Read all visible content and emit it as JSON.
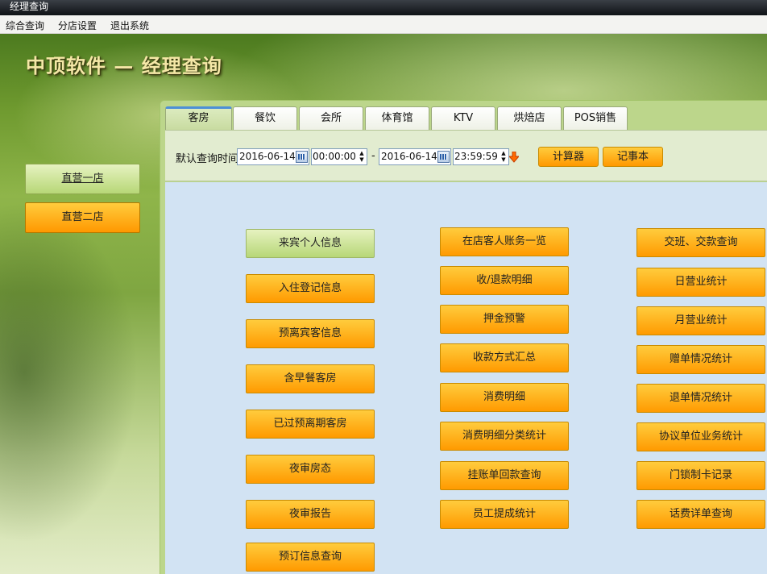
{
  "window": {
    "title": "经理查询"
  },
  "menu": [
    "综合查询",
    "分店设置",
    "退出系统"
  ],
  "header": {
    "logo": "中顶软件 — 经理查询"
  },
  "branches": [
    "直营一店",
    "直营二店"
  ],
  "tabs": [
    "客房",
    "餐饮",
    "会所",
    "体育馆",
    "KTV",
    "烘焙店",
    "POS销售"
  ],
  "filter": {
    "label": "默认查询时间",
    "start_date": "2016-06-14",
    "start_time": "00:00:00",
    "separator": "-",
    "end_date": "2016-06-14",
    "end_time": "23:59:59",
    "calculator_label": "计算器",
    "notepad_label": "记事本"
  },
  "functions": {
    "col1": [
      "来宾个人信息",
      "入住登记信息",
      "预离宾客信息",
      "含早餐客房",
      "已过预离期客房",
      "夜审房态",
      "夜审报告",
      "预订信息查询"
    ],
    "col2": [
      "在店客人账务一览",
      "收/退款明细",
      "押金预警",
      "收款方式汇总",
      "消费明细",
      "消费明细分类统计",
      "挂账单回款查询",
      "员工提成统计"
    ],
    "col3": [
      "交班、交款查询",
      "日营业统计",
      "月营业统计",
      "赠单情况统计",
      "退单情况统计",
      "协议单位业务统计",
      "门锁制卡记录",
      "话费详单查询"
    ]
  },
  "colors": {
    "button_orange": "#ff9f00",
    "button_selected": "#c4df86",
    "content_bg": "#d2e3f3",
    "tab_active_top": "#4d8fd6"
  },
  "icons": [
    "calendar-icon",
    "spin-arrows-icon",
    "down-arrow-icon"
  ]
}
